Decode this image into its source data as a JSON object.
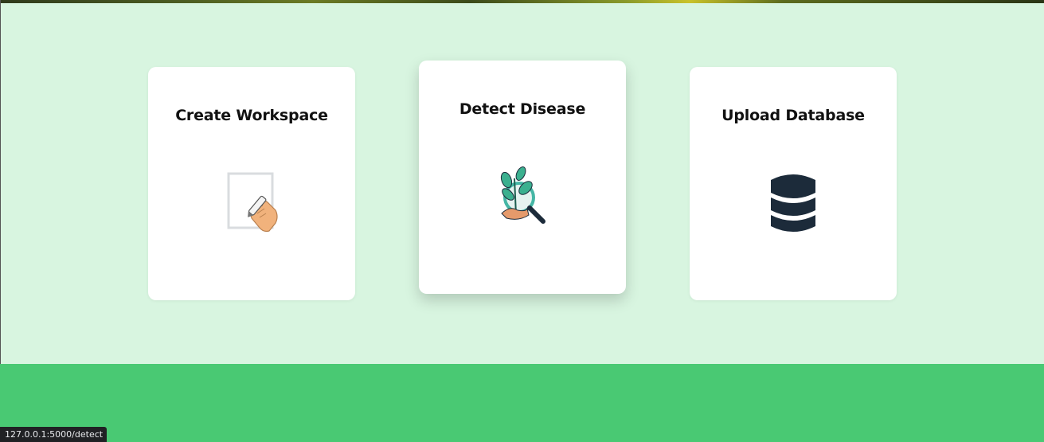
{
  "cards": [
    {
      "title": "Create Workspace",
      "icon": "pencil-hand-icon"
    },
    {
      "title": "Detect Disease",
      "icon": "plant-magnifier-icon"
    },
    {
      "title": "Upload Database",
      "icon": "database-icon"
    }
  ],
  "status_bar": {
    "url": "127.0.0.1:5000/detect"
  },
  "colors": {
    "page_background": "#d8f5e0",
    "footer": "#49c973",
    "card": "#ffffff",
    "database_icon": "#1c2b3a"
  }
}
